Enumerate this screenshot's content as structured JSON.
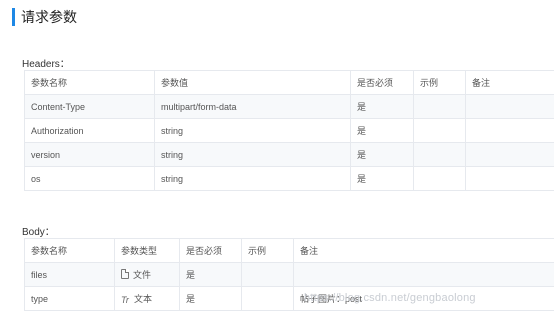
{
  "page": {
    "title": "请求参数",
    "headers_label": "Headers：",
    "body_label": "Body："
  },
  "headers_table": {
    "columns": [
      "参数名称",
      "参数值",
      "是否必须",
      "示例",
      "备注"
    ],
    "rows": [
      [
        "Content-Type",
        "multipart/form-data",
        "是",
        "",
        ""
      ],
      [
        "Authorization",
        "string",
        "是",
        "",
        ""
      ],
      [
        "version",
        "string",
        "是",
        "",
        ""
      ],
      [
        "os",
        "string",
        "是",
        "",
        ""
      ]
    ]
  },
  "body_table": {
    "columns": [
      "参数名称",
      "参数类型",
      "是否必须",
      "示例",
      "备注"
    ],
    "rows": [
      {
        "name": "files",
        "type_icon": "file-icon",
        "type": "文件",
        "required": "是",
        "example": "",
        "note": ""
      },
      {
        "name": "type",
        "type_icon": "text-icon",
        "type_glyph": "Tr",
        "type": "文本",
        "required": "是",
        "example": "",
        "note": "帖子图片：post"
      }
    ]
  },
  "watermark": "https://blog.csdn.net/gengbaolong",
  "colors": {
    "accent": "#1e88e5",
    "row_stripe": "#f7f9fb",
    "border": "#e6e9ee"
  }
}
